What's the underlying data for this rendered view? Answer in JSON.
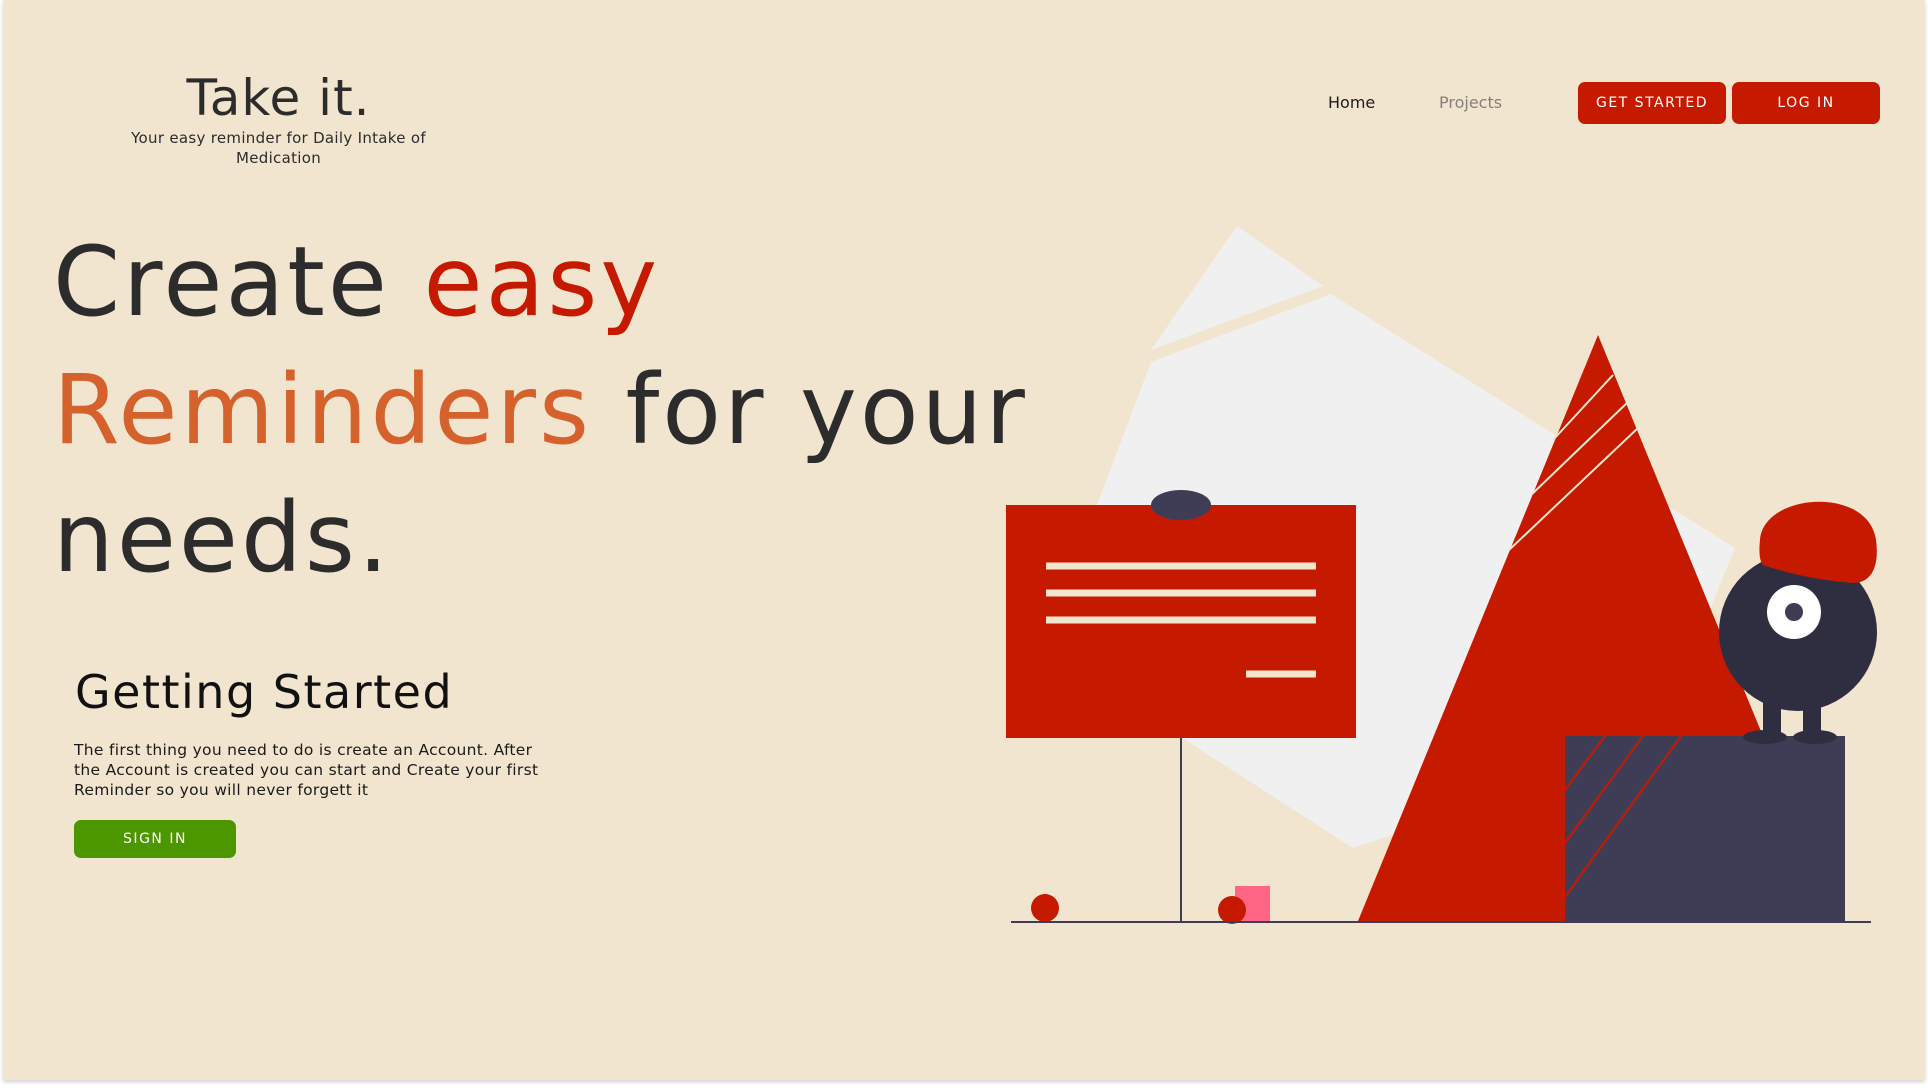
{
  "brand": {
    "title": "Take it.",
    "tagline": "Your easy reminder for Daily Intake of Medication"
  },
  "nav": {
    "home": "Home",
    "projects": "Projects",
    "get_started": "GET STARTED",
    "log_in": "LOG IN"
  },
  "hero": {
    "word1": "Create",
    "word2": "easy",
    "word3": "Reminders",
    "word4": "for your",
    "word5": "needs."
  },
  "getting_started": {
    "title": "Getting Started",
    "body": "The first thing you need to do is create an Account. After the Account is created you can start and Create your first Reminder so you will never forgett it",
    "sign_in": "SIGN IN"
  },
  "colors": {
    "background": "#f2e5cf",
    "primary_red": "#c61a00",
    "accent_orange": "#d5612c",
    "sign_in_green": "#4c9600",
    "dark_navy": "#3f3d56",
    "pink": "#ff6584"
  }
}
